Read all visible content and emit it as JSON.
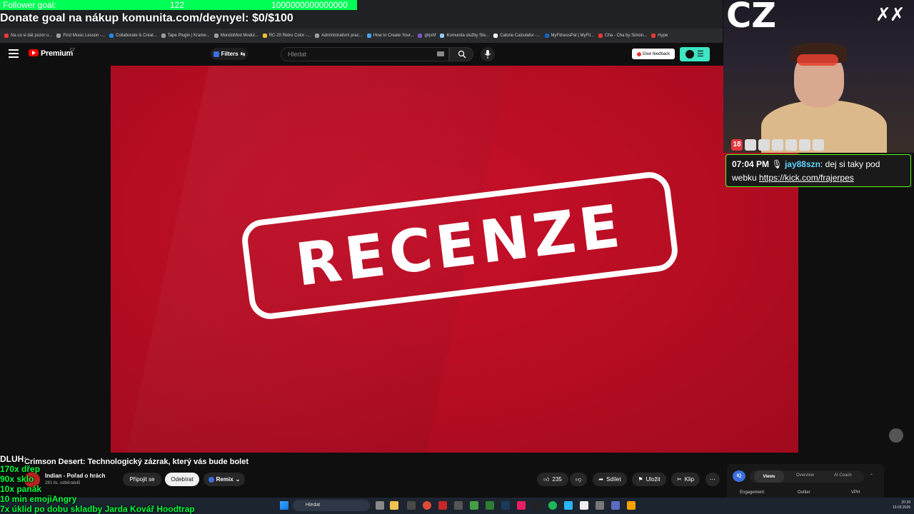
{
  "overlays": {
    "follower_goal_label": "Follower goal:",
    "follower_goal_current": "122",
    "follower_goal_target": "1000000000000000",
    "donate_text": "Donate goal na nákup komunita.com/deynyel: $0/$100",
    "stream_tag": "CZ",
    "top_right_mark": "✗✗",
    "list": [
      {
        "text": "DLUH:",
        "color": "white"
      },
      {
        "text": "170x dřep",
        "color": "green"
      },
      {
        "text": "90x sklo",
        "color": "green"
      },
      {
        "text": "10x panák",
        "color": "green"
      },
      {
        "text": "10 min emojiAngry",
        "color": "green"
      },
      {
        "text": "7x úklid po dobu skladby Jarda Kovář Hoodtrap",
        "color": "green"
      }
    ]
  },
  "bookmarks": [
    {
      "label": "Na co si dát pozor u...",
      "color": "#e53935"
    },
    {
      "label": "First Music Lesson -...",
      "color": "#9e9e9e"
    },
    {
      "label": "Collaborate & Creat...",
      "color": "#1e88e5"
    },
    {
      "label": "Tape Plugin | Krame...",
      "color": "#9e9e9e"
    },
    {
      "label": "MondoMod Modul...",
      "color": "#9e9e9e"
    },
    {
      "label": "RC-20 Retro Color -...",
      "color": "#fbc02d"
    },
    {
      "label": "Administrativní prac...",
      "color": "#9e9e9e"
    },
    {
      "label": "How to Create Your...",
      "color": "#42a5f5"
    },
    {
      "label": "ghjshf",
      "color": "#7e57c2"
    },
    {
      "label": "Komunita služby Ste...",
      "color": "#90caf9"
    },
    {
      "label": "Calorie Calculator -...",
      "color": "#ffffff"
    },
    {
      "label": "MyFitnessPal | MyFit...",
      "color": "#1565c0"
    },
    {
      "label": "Cha - Cha by Simon...",
      "color": "#e53935"
    },
    {
      "label": "Hype",
      "color": "#e53935"
    }
  ],
  "header": {
    "logo_text": "Premium",
    "logo_region": "CZ",
    "filters_label": "Filters",
    "search_placeholder": "Hledat",
    "feedback_label": "Give feedback"
  },
  "video": {
    "banner_text": "RECENZE",
    "title": "Crimson Desert: Technologický zázrak, který vás bude bolet"
  },
  "channel": {
    "name": "Indian - Pořad o hrách",
    "subscribers": "281 tis. odběratelů",
    "join_label": "Připojit se",
    "subscribe_label": "Odebírat",
    "remix_label": "Remix"
  },
  "actions": {
    "like_count": "235",
    "share_label": "Sdílet",
    "save_label": "Uložit",
    "clip_label": "Klip"
  },
  "side_panel": {
    "badge": "IQ",
    "tabs": [
      "Views",
      "Overview",
      "AI Coach"
    ],
    "columns": [
      "Engagement",
      "Outlier",
      "VPH"
    ]
  },
  "chat": {
    "time": "07:04 PM",
    "user": "jay88szn",
    "message_prefix": ": dej si taky pod webku ",
    "link": "https://kick.com/frajerpes"
  },
  "taskbar": {
    "search_label": "Hledat",
    "time": "20:39",
    "date": "19.03.2026"
  }
}
